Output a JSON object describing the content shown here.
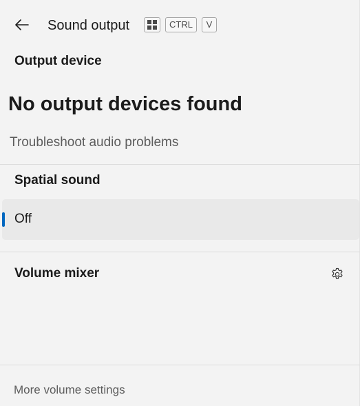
{
  "header": {
    "title": "Sound output",
    "back_icon": "back-arrow-icon",
    "shortcut": {
      "win_icon": "windows-key-icon",
      "ctrl": "CTRL",
      "v": "V"
    }
  },
  "output_device": {
    "label": "Output device",
    "status": "No output devices found",
    "troubleshoot_link": "Troubleshoot audio problems"
  },
  "spatial_sound": {
    "label": "Spatial sound",
    "selected_option": "Off",
    "accent_color": "#0067c0"
  },
  "volume_mixer": {
    "label": "Volume mixer",
    "settings_icon": "gear-icon"
  },
  "footer": {
    "more_settings": "More volume settings"
  }
}
